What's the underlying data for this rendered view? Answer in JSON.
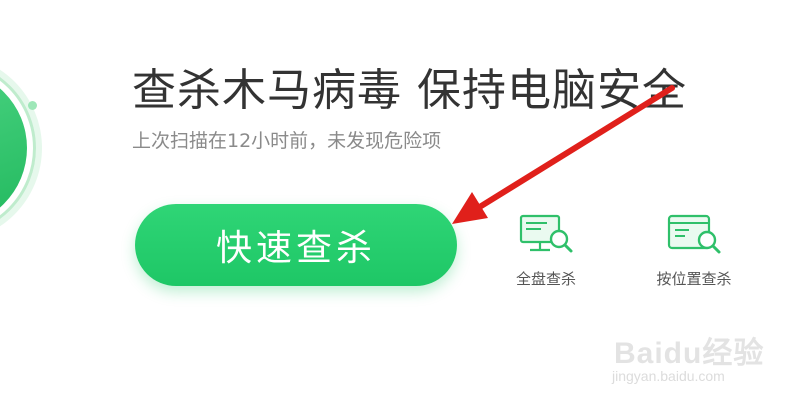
{
  "main": {
    "headline": "查杀木马病毒 保持电脑安全",
    "subline": "上次扫描在12小时前，未发现危险项",
    "quick_scan_label": "快速查杀"
  },
  "tools": [
    {
      "label": "全盘查杀",
      "icon": "monitor-magnifier-icon"
    },
    {
      "label": "按位置查杀",
      "icon": "window-magnifier-icon"
    }
  ],
  "watermark": {
    "logo": "Baidu经验",
    "url": "jingyan.baidu.com"
  },
  "colors": {
    "accent": "#1ec766",
    "arrow": "#e0201b",
    "headline": "#333333",
    "subline": "#8a8a8a"
  }
}
